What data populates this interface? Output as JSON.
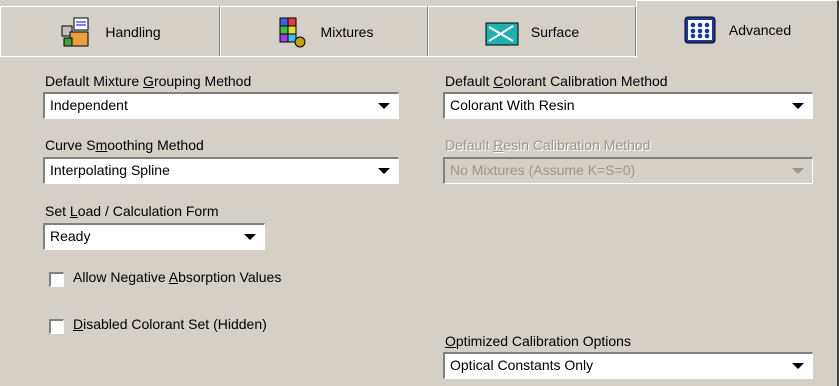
{
  "tabs": [
    {
      "label": "Handling",
      "icon": "handling-icon"
    },
    {
      "label": "Mixtures",
      "icon": "mixtures-icon"
    },
    {
      "label": "Surface",
      "icon": "surface-icon"
    },
    {
      "label": "Advanced",
      "icon": "advanced-icon",
      "active": true
    }
  ],
  "left": {
    "grouping": {
      "label_pre": "Default Mixture ",
      "label_key": "G",
      "label_post": "rouping Method",
      "value": "Independent"
    },
    "smoothing": {
      "label_pre": "Curve S",
      "label_key": "m",
      "label_post": "oothing Method",
      "value": "Interpolating Spline"
    },
    "load_form": {
      "label_pre": "Set ",
      "label_key": "L",
      "label_post": "oad / Calculation Form",
      "value": "Ready"
    },
    "neg_absorption": {
      "label_pre": "Allow Negative ",
      "label_key": "A",
      "label_post": "bsorption Values",
      "checked": false
    },
    "disabled_set": {
      "label_pre": "",
      "label_key": "D",
      "label_post": "isabled Colorant Set (Hidden)",
      "checked": false
    }
  },
  "right": {
    "colorant_cal": {
      "label_pre": "Default ",
      "label_key": "C",
      "label_post": "olorant Calibration Method",
      "value": "Colorant With Resin"
    },
    "resin_cal": {
      "label_pre": "Default ",
      "label_key": "R",
      "label_post": "esin Calibration Method",
      "value": "No Mixtures (Assume K=S=0)",
      "disabled": true
    },
    "optimized": {
      "label_pre": "",
      "label_key": "O",
      "label_post": "ptimized Calibration Options",
      "value": "Optical Constants Only"
    }
  }
}
